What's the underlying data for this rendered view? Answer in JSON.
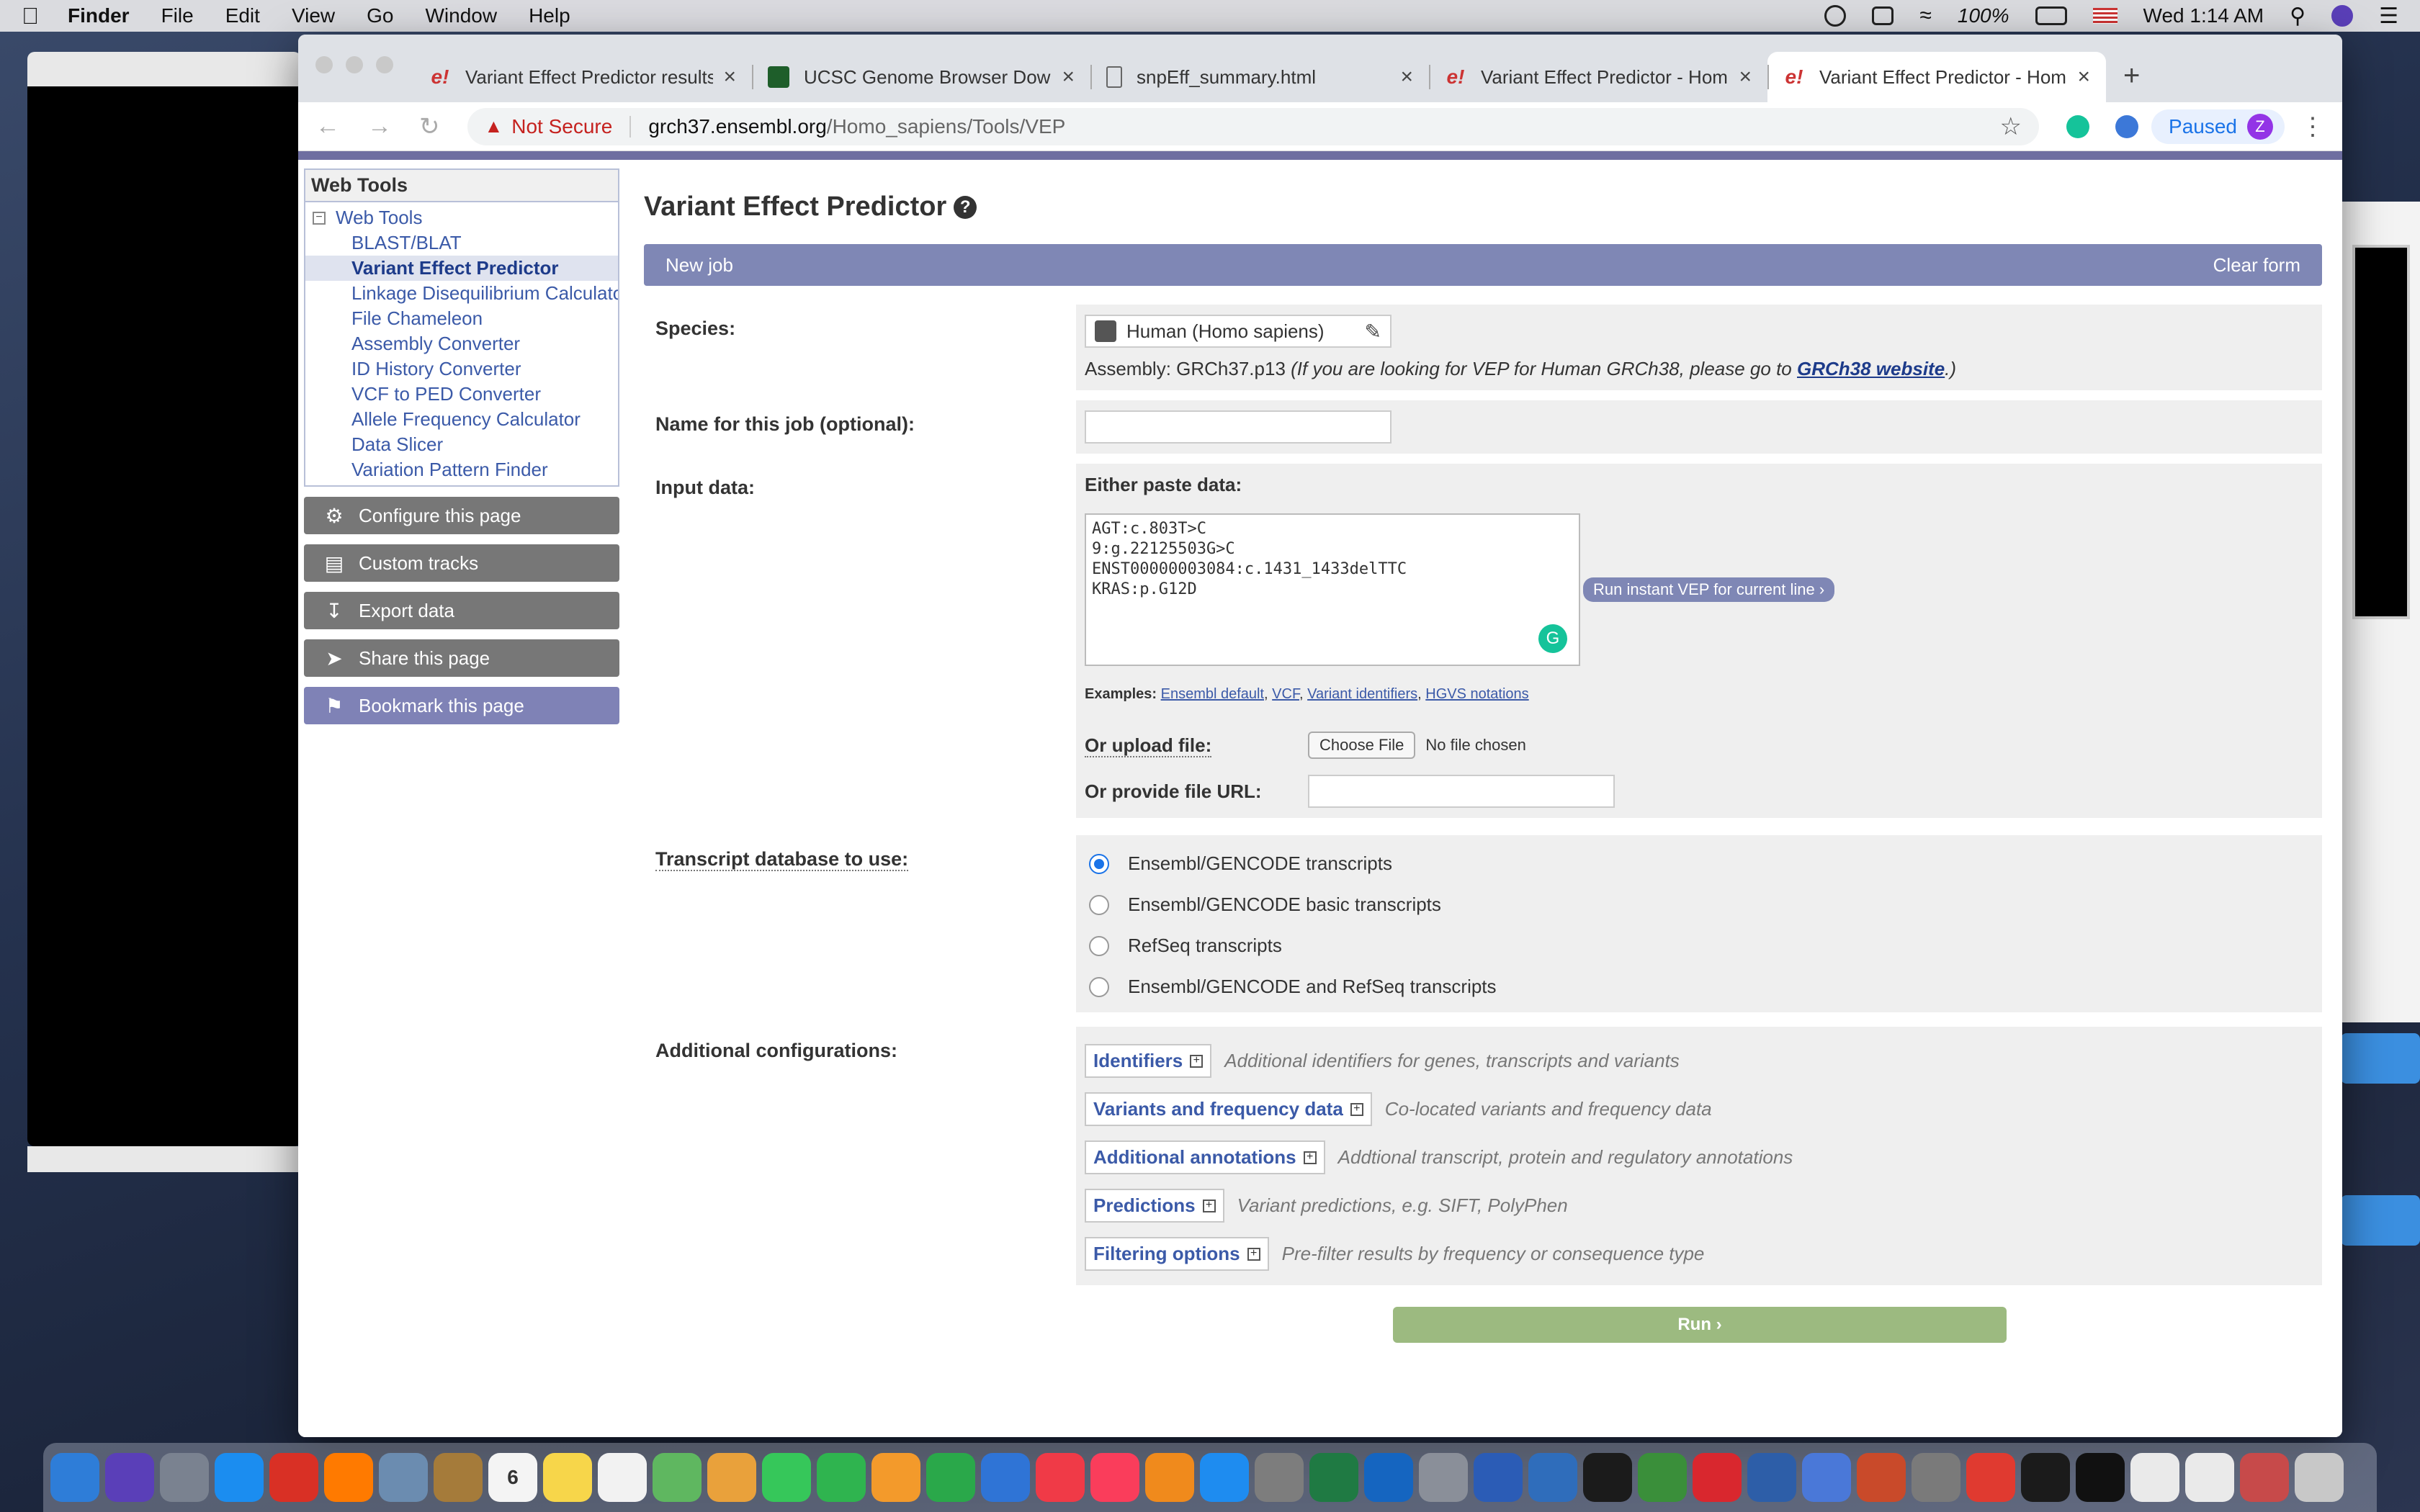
{
  "menubar": {
    "app": "Finder",
    "items": [
      "File",
      "Edit",
      "View",
      "Go",
      "Window",
      "Help"
    ],
    "battery": "100%",
    "clock": "Wed 1:14 AM"
  },
  "browser": {
    "tabs": [
      {
        "title": "Variant Effect Predictor results",
        "favicon": "ensembl-icon"
      },
      {
        "title": "UCSC Genome Browser Downl",
        "favicon": "ucsc-icon"
      },
      {
        "title": "snpEff_summary.html",
        "favicon": "document-icon"
      },
      {
        "title": "Variant Effect Predictor - Hom",
        "favicon": "ensembl-icon"
      },
      {
        "title": "Variant Effect Predictor - Hom",
        "favicon": "ensembl-icon"
      }
    ],
    "address": {
      "security": "Not Secure",
      "host": "grch37.ensembl.org",
      "path": "/Homo_sapiens/Tools/VEP"
    },
    "profile_status": "Paused",
    "avatar_letter": "Z"
  },
  "sidebar": {
    "header": "Web Tools",
    "root": "Web Tools",
    "items": [
      "BLAST/BLAT",
      "Variant Effect Predictor",
      "Linkage Disequilibrium Calculato",
      "File Chameleon",
      "Assembly Converter",
      "ID History Converter",
      "VCF to PED Converter",
      "Allele Frequency Calculator",
      "Data Slicer",
      "Variation Pattern Finder"
    ],
    "buttons": [
      "Configure this page",
      "Custom tracks",
      "Export data",
      "Share this page",
      "Bookmark this page"
    ]
  },
  "main": {
    "title": "Variant Effect Predictor",
    "new_job": "New job",
    "clear_form": "Clear form",
    "species_label": "Species:",
    "species_value": "Human (Homo sapiens)",
    "assembly_prefix": "Assembly: GRCh37.p13",
    "assembly_note": "(If you are looking for VEP for Human GRCh38, please go to",
    "assembly_link": "GRCh38 website",
    "assembly_suffix": ".)",
    "job_name_label": "Name for this job (optional):",
    "input_label": "Input data:",
    "paste_label": "Either paste data:",
    "paste_value": "AGT:c.803T>C\n9:g.22125503G>C\nENST00000003084:c.1431_1433delTTC\nKRAS:p.G12D",
    "instant_vep": "Run instant VEP for current line ›",
    "examples_label": "Examples:",
    "examples": [
      "Ensembl default",
      "VCF",
      "Variant identifiers",
      "HGVS notations"
    ],
    "upload_label": "Or upload file:",
    "choose_file": "Choose File",
    "no_file": "No file chosen",
    "url_label": "Or provide file URL:",
    "transcript_label": "Transcript database to use:",
    "transcripts": [
      {
        "label": "Ensembl/GENCODE transcripts",
        "selected": true
      },
      {
        "label": "Ensembl/GENCODE basic transcripts",
        "selected": false
      },
      {
        "label": "RefSeq transcripts",
        "selected": false
      },
      {
        "label": "Ensembl/GENCODE and RefSeq transcripts",
        "selected": false
      }
    ],
    "additional_label": "Additional configurations:",
    "configs": [
      {
        "name": "Identifiers",
        "desc": "Additional identifiers for genes, transcripts and variants"
      },
      {
        "name": "Variants and frequency data",
        "desc": "Co-located variants and frequency data"
      },
      {
        "name": "Additional annotations",
        "desc": "Addtional transcript, protein and regulatory annotations"
      },
      {
        "name": "Predictions",
        "desc": "Variant predictions, e.g. SIFT, PolyPhen"
      },
      {
        "name": "Filtering options",
        "desc": "Pre-filter results by frequency or consequence type"
      }
    ],
    "run": "Run ›"
  },
  "dock": {
    "calendar_day": "6",
    "icons": [
      {
        "name": "finder-icon",
        "color": "#2e7dd8"
      },
      {
        "name": "siri-icon",
        "color": "#5a3fb8"
      },
      {
        "name": "launchpad-icon",
        "color": "#7a8290"
      },
      {
        "name": "safari-icon",
        "color": "#1b8df0"
      },
      {
        "name": "chrome-icon",
        "color": "#d93025"
      },
      {
        "name": "firefox-icon",
        "color": "#ff7a00"
      },
      {
        "name": "preview-icon",
        "color": "#6b8cb0"
      },
      {
        "name": "notefile-icon",
        "color": "#a57b3a"
      },
      {
        "name": "calendar-icon",
        "color": "#f4f4f4"
      },
      {
        "name": "notes-icon",
        "color": "#f7d64a"
      },
      {
        "name": "reminders-icon",
        "color": "#f2f2f2"
      },
      {
        "name": "maps-icon",
        "color": "#5fb760"
      },
      {
        "name": "photos-icon",
        "color": "#e9a13b"
      },
      {
        "name": "messages-icon",
        "color": "#36c75a"
      },
      {
        "name": "facetime-icon",
        "color": "#2fb44f"
      },
      {
        "name": "pages-icon",
        "color": "#f39a2b"
      },
      {
        "name": "numbers-icon",
        "color": "#2aa84a"
      },
      {
        "name": "keynote-icon",
        "color": "#2f74d6"
      },
      {
        "name": "news-icon",
        "color": "#f03a47"
      },
      {
        "name": "music-icon",
        "color": "#fa3d5b"
      },
      {
        "name": "books-icon",
        "color": "#f08a1c"
      },
      {
        "name": "appstore-icon",
        "color": "#1e8cf0"
      },
      {
        "name": "system-preferences-icon",
        "color": "#7d7d7d"
      },
      {
        "name": "excel-icon",
        "color": "#1f7a43"
      },
      {
        "name": "outlook-icon",
        "color": "#1565c0"
      },
      {
        "name": "disk-icon",
        "color": "#8a8f99"
      },
      {
        "name": "word-icon",
        "color": "#2b5cb6"
      },
      {
        "name": "r-icon",
        "color": "#2f6dbb"
      },
      {
        "name": "pycharm-icon",
        "color": "#1b1b1b"
      },
      {
        "name": "sync-icon",
        "color": "#3a8f3a"
      },
      {
        "name": "youdao-icon",
        "color": "#d9272e"
      },
      {
        "name": "virtualbox-icon",
        "color": "#2d5ea8"
      },
      {
        "name": "chromium-icon",
        "color": "#4a78d8"
      },
      {
        "name": "powerpoint-icon",
        "color": "#c94a2a"
      },
      {
        "name": "tex-icon",
        "color": "#7a7a7a"
      },
      {
        "name": "pdf-icon",
        "color": "#e03a30"
      },
      {
        "name": "activity-icon",
        "color": "#1b1b1b"
      },
      {
        "name": "terminal-icon",
        "color": "#111111"
      },
      {
        "name": "document-icon",
        "color": "#eaeaea"
      },
      {
        "name": "document2-icon",
        "color": "#eaeaea"
      },
      {
        "name": "folder-icon",
        "color": "#c74a4a"
      },
      {
        "name": "trash-icon",
        "color": "#c8c8c8"
      }
    ]
  }
}
